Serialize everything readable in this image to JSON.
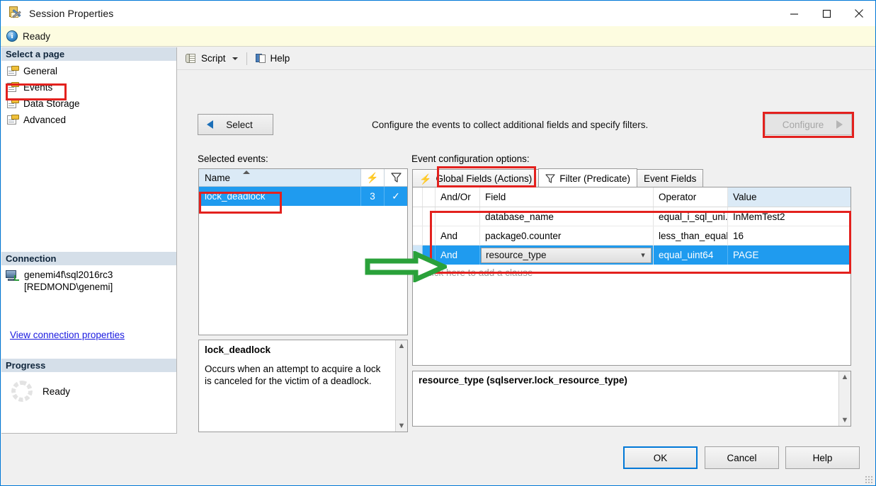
{
  "window": {
    "title": "Session Properties",
    "icon": "session-properties-icon",
    "minimize": "minimize-icon",
    "maximize": "maximize-icon",
    "close": "close-icon"
  },
  "infobar": {
    "icon": "info-icon",
    "text": "Ready"
  },
  "sidebar": {
    "header": "Select a page",
    "items": [
      {
        "label": "General",
        "selected": false
      },
      {
        "label": "Events",
        "selected": true
      },
      {
        "label": "Data Storage",
        "selected": false
      },
      {
        "label": "Advanced",
        "selected": false
      }
    ],
    "connection": {
      "header": "Connection",
      "server": "genemi4f\\sql2016rc3",
      "user": "[REDMOND\\genemi]",
      "link": "View connection properties"
    },
    "progress": {
      "header": "Progress",
      "status": "Ready"
    }
  },
  "toolbar": {
    "script_label": "Script",
    "help_label": "Help"
  },
  "main": {
    "select_button": "Select",
    "configure_button": "Configure",
    "configure_disabled": true,
    "instruction": "Configure the events to collect additional fields and specify filters.",
    "selected_events_label": "Selected events:",
    "event_config_label": "Event configuration options:",
    "events_grid": {
      "columns": [
        "Name",
        "actions-count",
        "filter-flag"
      ],
      "column_name": "Name",
      "rows": [
        {
          "name": "lock_deadlock",
          "count": "3",
          "filter": "✓",
          "selected": true
        }
      ]
    },
    "event_description": {
      "title": "lock_deadlock",
      "text": "Occurs when an attempt to acquire a lock is canceled for the victim of a deadlock."
    },
    "tabs": [
      {
        "label": "Global Fields (Actions)",
        "icon": "lightning-icon",
        "active": false
      },
      {
        "label": "Filter (Predicate)",
        "icon": "funnel-icon",
        "active": true
      },
      {
        "label": "Event Fields",
        "icon": "",
        "active": false
      }
    ],
    "filter_grid": {
      "columns": [
        "And/Or",
        "Field",
        "Operator",
        "Value"
      ],
      "rows": [
        {
          "andor": "",
          "field": "database_name",
          "operator": "equal_i_sql_uni...",
          "value": "InMemTest2",
          "selected": false,
          "editing": false
        },
        {
          "andor": "And",
          "field": "package0.counter",
          "operator": "less_than_equal...",
          "value": "16",
          "selected": false,
          "editing": false
        },
        {
          "andor": "And",
          "field": "resource_type",
          "operator": "equal_uint64",
          "value": "PAGE",
          "selected": true,
          "editing": true
        }
      ],
      "add_clause": "Click here to add a clause"
    },
    "filter_description": {
      "title": "resource_type (sqlserver.lock_resource_type)"
    }
  },
  "footer": {
    "ok": "OK",
    "cancel": "Cancel",
    "help": "Help"
  },
  "colors": {
    "accent": "#1f9bef",
    "annotation_red": "#e3211e",
    "annotation_green": "#2aa13a",
    "info_bg": "#fdfce0",
    "link": "#1a1ae0"
  }
}
